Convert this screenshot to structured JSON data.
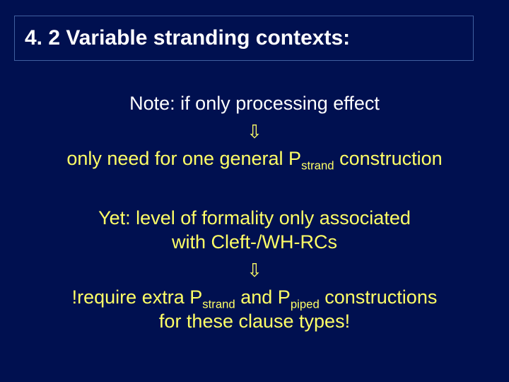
{
  "title": "4. 2 Variable stranding contexts:",
  "lines": {
    "note": "Note: if only processing effect",
    "arrow1": "⇩",
    "need_pre": "only need for one general P",
    "need_sub": "strand",
    "need_post": " construction",
    "yet1": "Yet: level of formality only associated",
    "yet2": "with Cleft-/WH-RCs",
    "arrow2": "⇩",
    "req_pre": "!require extra P",
    "req_sub1": "strand",
    "req_mid": " and P",
    "req_sub2": "piped",
    "req_post": " constructions",
    "req2": "for these clause types!"
  }
}
